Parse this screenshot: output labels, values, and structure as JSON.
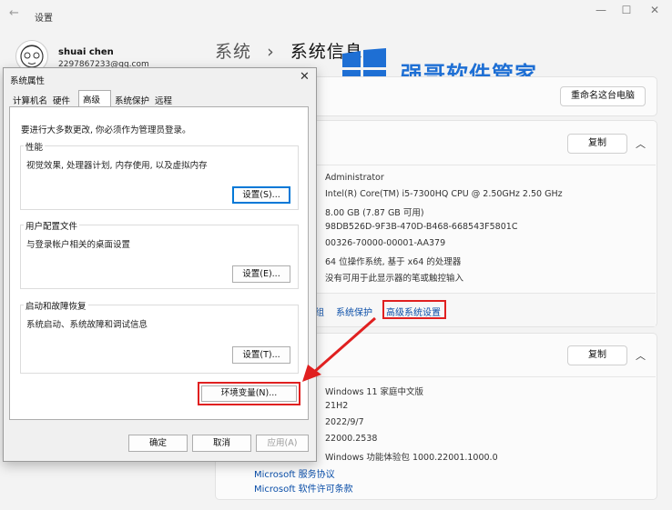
{
  "settings": {
    "window_title": "设置",
    "user_name": "shuai chen",
    "user_email": "2297867233@qq.com",
    "breadcrumb_parent": "系统",
    "breadcrumb_sep": "›",
    "breadcrumb_current": "系统信息",
    "rename_button": "重命名这台电脑",
    "copy_button_1": "复制",
    "copy_button_2": "复制",
    "device_specs": [
      "Administrator",
      "Intel(R) Core(TM) i5-7300HQ CPU @ 2.50GHz   2.50 GHz",
      "8.00 GB (7.87 GB 可用)",
      "98DB526D-9F3B-470D-B468-668543F5801C",
      "00326-70000-00001-AA379",
      "64 位操作系统, 基于 x64 的处理器",
      "没有可用于此显示器的笔或触控输入"
    ],
    "related_links": {
      "partial": "组",
      "system_protection": "系统保护",
      "advanced_settings": "高级系统设置"
    },
    "windows_specs": [
      "Windows 11 家庭中文版",
      "21H2",
      "2022/9/7",
      "22000.2538",
      "Windows 功能体验包 1000.22001.1000.0"
    ],
    "footer_links": [
      "Microsoft 服务协议",
      "Microsoft 软件许可条款"
    ]
  },
  "watermark": {
    "text": "强哥软件管家",
    "color": "#1e6fd4"
  },
  "dialog": {
    "title": "系统属性",
    "close": "✕",
    "tabs": [
      "计算机名",
      "硬件",
      "高级",
      "系统保护",
      "远程"
    ],
    "active_tab": "高级",
    "admin_note": "要进行大多数更改, 你必须作为管理员登录。",
    "performance": {
      "label": "性能",
      "desc": "视觉效果, 处理器计划, 内存使用, 以及虚拟内存",
      "button": "设置(S)..."
    },
    "user_profiles": {
      "label": "用户配置文件",
      "desc": "与登录帐户相关的桌面设置",
      "button": "设置(E)..."
    },
    "startup_recovery": {
      "label": "启动和故障恢复",
      "desc": "系统启动、系统故障和调试信息",
      "button": "设置(T)..."
    },
    "env_button": "环境变量(N)...",
    "ok": "确定",
    "cancel": "取消",
    "apply": "应用(A)"
  },
  "highlight_color": "#e02020"
}
